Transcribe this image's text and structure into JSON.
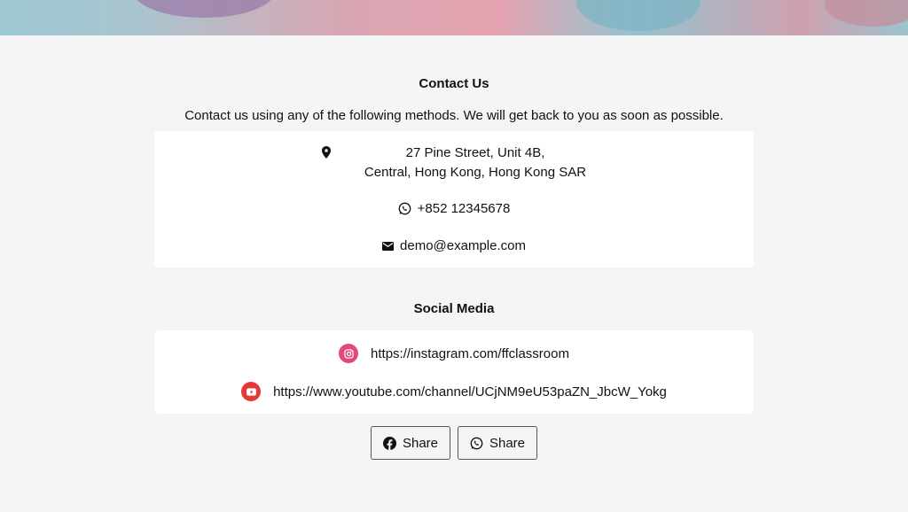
{
  "contact": {
    "title": "Contact Us",
    "intro": "Contact us using any of the following methods. We will get back to you as soon as possible.",
    "address_line1": "27 Pine Street, Unit 4B,",
    "address_line2": "Central, Hong Kong, Hong Kong SAR",
    "phone": "+852 12345678",
    "email": "demo@example.com",
    "icons": {
      "address": "map-pin-icon",
      "phone": "whatsapp-icon",
      "email": "envelope-icon"
    }
  },
  "social": {
    "title": "Social Media",
    "instagram": {
      "url": "https://instagram.com/ffclassroom",
      "icon": "instagram-icon",
      "color": "#e1497a"
    },
    "youtube": {
      "url": "https://www.youtube.com/channel/UCjNM9eU53paZN_JbcW_Yokg",
      "icon": "youtube-icon",
      "color": "#e53935"
    }
  },
  "share": {
    "facebook_label": "Share",
    "whatsapp_label": "Share"
  }
}
